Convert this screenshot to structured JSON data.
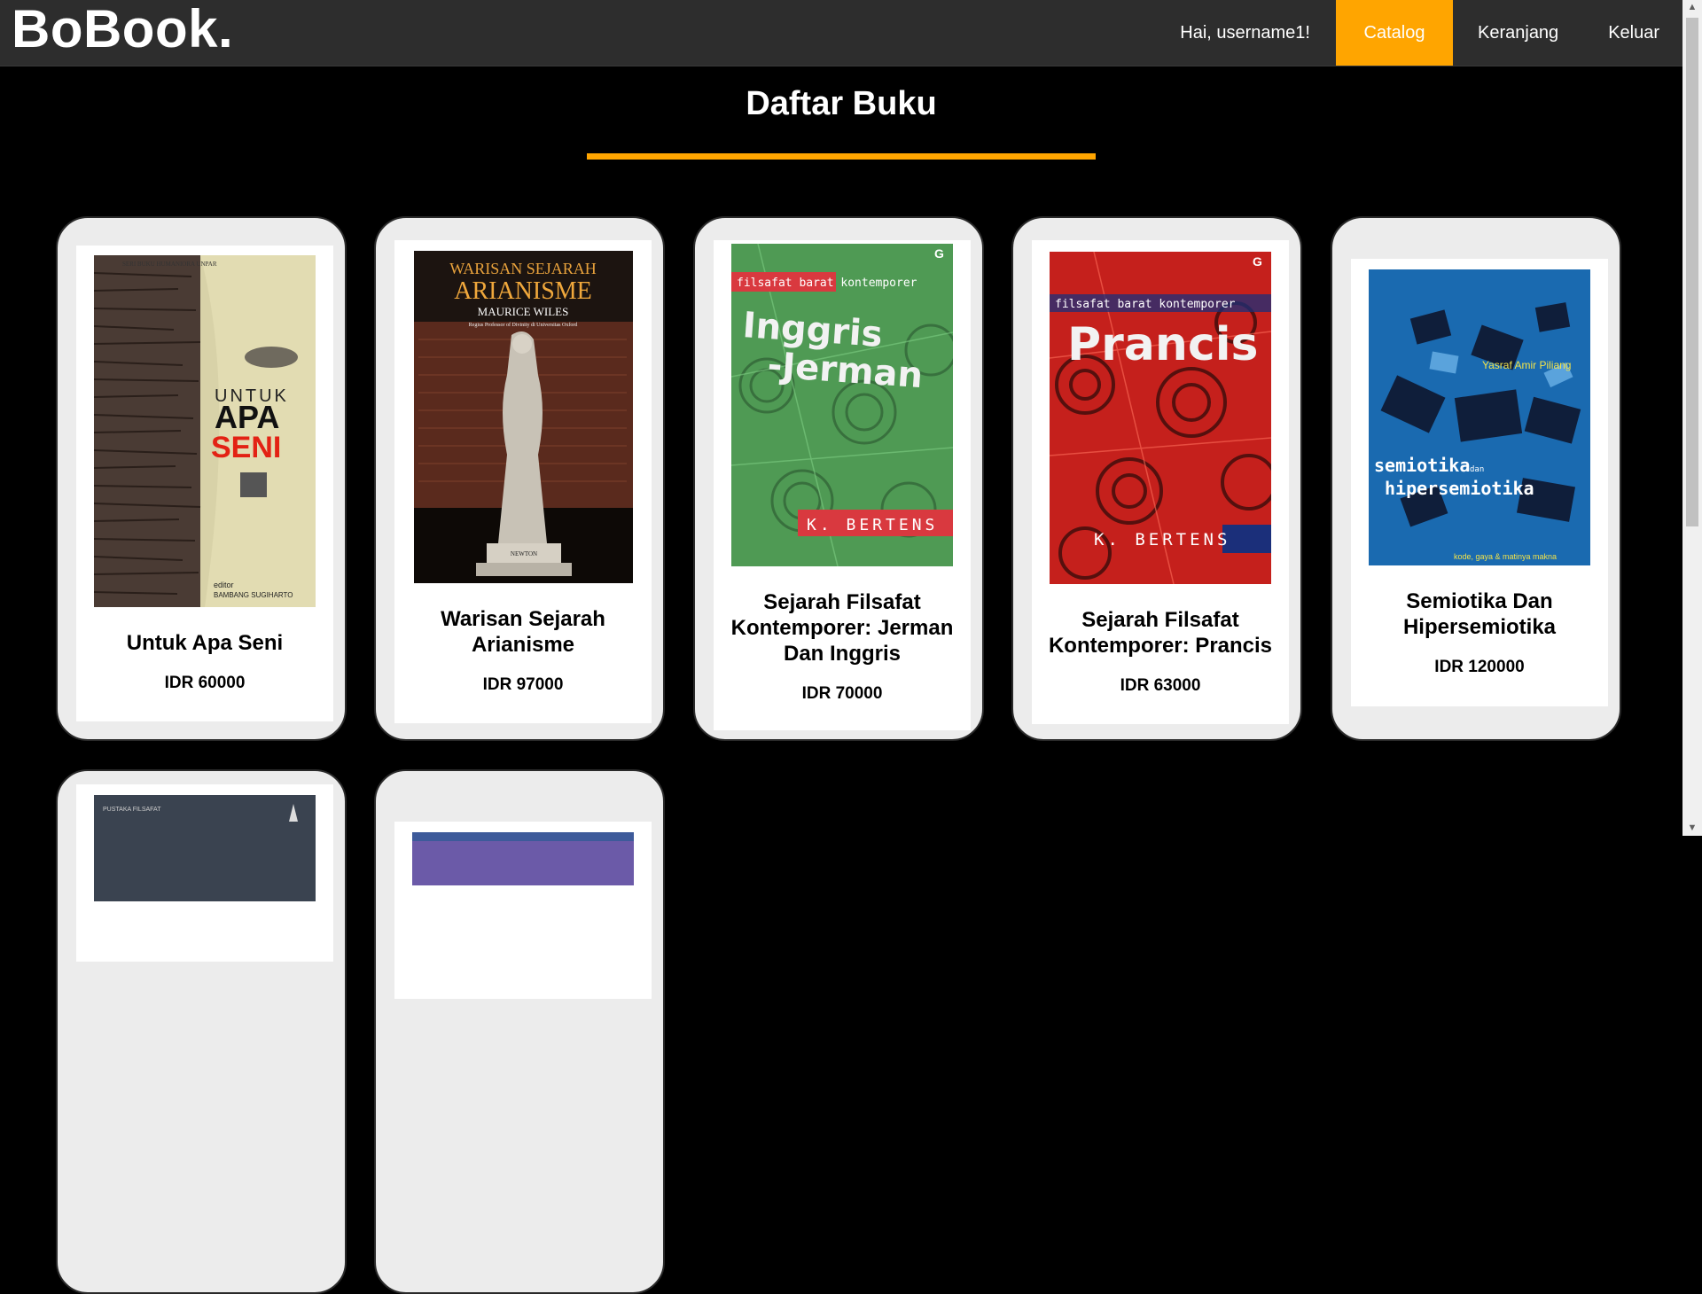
{
  "app": {
    "logo": "BoBook."
  },
  "nav": {
    "greeting": "Hai, username1!",
    "catalog": "Catalog",
    "cart": "Keranjang",
    "logout": "Keluar",
    "accent_color": "#ffa500"
  },
  "page": {
    "title": "Daftar Buku"
  },
  "books": [
    {
      "title": "Untuk Apa Seni",
      "price": "IDR 60000",
      "cover": {
        "series": "SERI BUKU HUMANIORA UNPAR",
        "line1": "UNTUK",
        "line2": "APA",
        "line3": "SENI",
        "editor_label": "editor",
        "editor": "BAMBANG SUGIHARTO"
      }
    },
    {
      "title": "Warisan Sejarah Arianisme",
      "price": "IDR 97000",
      "cover": {
        "heading": "WARISAN SEJARAH",
        "title": "ARIANISME",
        "author": "MAURICE WILES",
        "affiliation": "Regius Professor of Divinity di Universitas Oxford",
        "statue_label": "NEWTON"
      }
    },
    {
      "title": "Sejarah Filsafat Kontemporer: Jerman Dan Inggris",
      "price": "IDR 70000",
      "cover": {
        "series": "filsafat barat kontemporer",
        "title": "Inggris -Jerman",
        "author": "K. BERTENS",
        "publisher_mark": "G"
      }
    },
    {
      "title": "Sejarah Filsafat Kontemporer: Prancis",
      "price": "IDR 63000",
      "cover": {
        "series": "filsafat barat kontemporer",
        "title": "Prancis",
        "author": "K. BERTENS",
        "publisher_mark": "G"
      }
    },
    {
      "title": "Semiotika Dan Hipersemiotika",
      "price": "IDR 120000",
      "cover": {
        "author": "Yasraf Amir Piliang",
        "title": "semiotika dan hipersemiotika",
        "subtitle": "kode, gaya & matinya makna"
      }
    },
    {
      "title": "",
      "price": "",
      "cover": {
        "series": "PUSTAKA FILSAFAT"
      }
    },
    {
      "title": "",
      "price": "",
      "cover": {}
    }
  ]
}
